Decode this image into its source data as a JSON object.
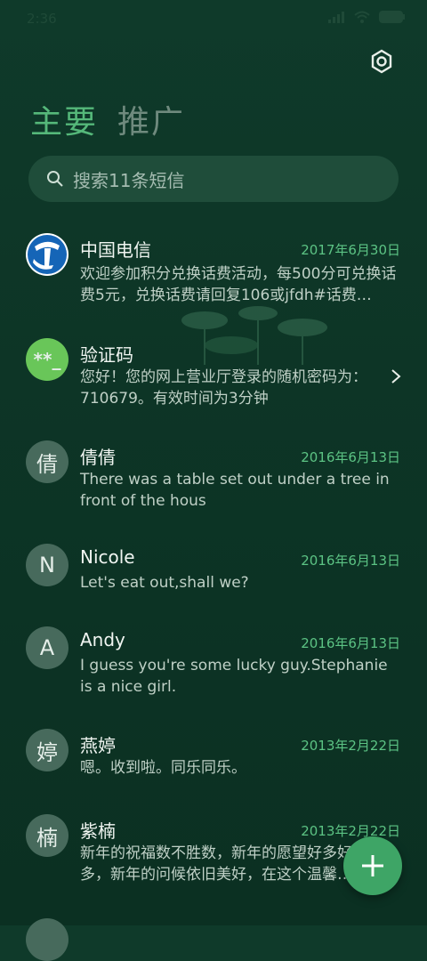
{
  "status": {
    "time": "2:36"
  },
  "tabs": [
    {
      "label": "主要"
    },
    {
      "label": "推广"
    }
  ],
  "search": {
    "placeholder": "搜索11条短信"
  },
  "messages": [
    {
      "name": "中国电信",
      "date": "2017年6月30日",
      "preview": "欢迎参加积分兑换话费活动，每500分可兑换话费5元，兑换话费请回复106或jfdh#话费…",
      "avatar_text": "",
      "avatar_type": "telecom-logo"
    },
    {
      "name": "验证码",
      "date": "",
      "preview": "您好！您的网上营业厅登录的随机密码为：710679。有效时间为3分钟",
      "avatar_text": "**_",
      "avatar_type": "code"
    },
    {
      "name": "倩倩",
      "date": "2016年6月13日",
      "preview": "There was a table set out under a tree in front of the hous",
      "avatar_text": "倩"
    },
    {
      "name": "Nicole",
      "date": "2016年6月13日",
      "preview": "Let's eat out,shall we?",
      "avatar_text": "N"
    },
    {
      "name": "Andy",
      "date": "2016年6月13日",
      "preview": "I guess you're some lucky guy.Stephanie is a nice girl.",
      "avatar_text": "A"
    },
    {
      "name": "燕婷",
      "date": "2013年2月22日",
      "preview": "嗯。收到啦。同乐同乐。",
      "avatar_text": "婷"
    },
    {
      "name": "紫楠",
      "date": "2013年2月22日",
      "preview": "新年的祝福数不胜数，新年的愿望好多好多，新年的问候依旧美好，在这个温馨的时刻",
      "avatar_text": "楠"
    },
    {
      "name": "",
      "date": "",
      "preview": "",
      "avatar_text": ""
    }
  ],
  "colors": {
    "accent": "#55b87a",
    "date": "#5cc384",
    "fab": "#3ea566",
    "background": "#0f3a2a"
  },
  "icons": [
    "settings-icon",
    "search-icon",
    "chevron-right-icon",
    "plus-icon"
  ]
}
